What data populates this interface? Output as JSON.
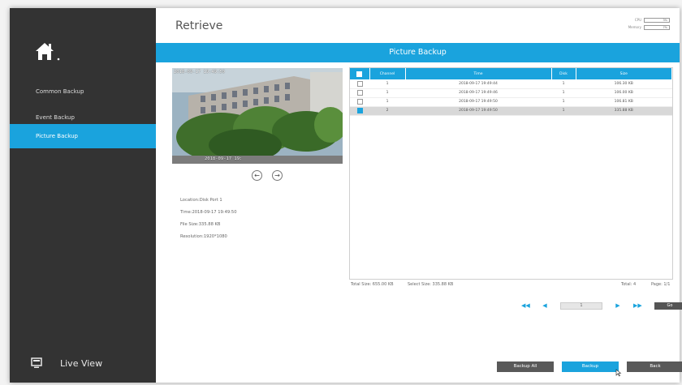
{
  "sidebar": {
    "items": [
      {
        "label": "Common Backup"
      },
      {
        "label": "Event Backup"
      },
      {
        "label": "Picture Backup"
      }
    ],
    "live_view": "Live View"
  },
  "header": {
    "title": "Retrieve",
    "cpu_label": "CPU",
    "cpu_value": "3%",
    "memory_label": "Memory",
    "memory_value": "7%"
  },
  "banner": "Picture Backup",
  "preview": {
    "caption_top": "2018-09-17 19:49:50",
    "caption_bottom": "2018-09-17 19:"
  },
  "info": {
    "location": "Location:Disk Port 1",
    "time": "Time:2018-09-17 19:49:50",
    "file_size": "File Size:335.88 KB",
    "resolution": "Resolution:1920*1080"
  },
  "table": {
    "headers": [
      "Channel",
      "Time",
      "Disk",
      "Size"
    ],
    "rows": [
      {
        "channel": "1",
        "time": "2018-09-17 19:49:44",
        "disk": "1",
        "size": "106.30 KB",
        "checked": false
      },
      {
        "channel": "1",
        "time": "2018-09-17 19:49:46",
        "disk": "1",
        "size": "106.00 KB",
        "checked": false
      },
      {
        "channel": "1",
        "time": "2018-09-17 19:49:50",
        "disk": "1",
        "size": "106.81 KB",
        "checked": false
      },
      {
        "channel": "2",
        "time": "2018-09-17 19:49:50",
        "disk": "1",
        "size": "335.88 KB",
        "checked": true
      }
    ]
  },
  "summary": {
    "total_size": "Total Size: 655.00 KB",
    "select_size": "Select Size: 335.88 KB",
    "total": "Total: 4",
    "page": "Page: 1/1"
  },
  "pager": {
    "current_page": "1",
    "go_label": "Go"
  },
  "buttons": {
    "backup_all": "Backup All",
    "backup": "Backup",
    "back": "Back"
  },
  "colors": {
    "accent": "#1aa3dd",
    "sidebar": "#333333"
  }
}
